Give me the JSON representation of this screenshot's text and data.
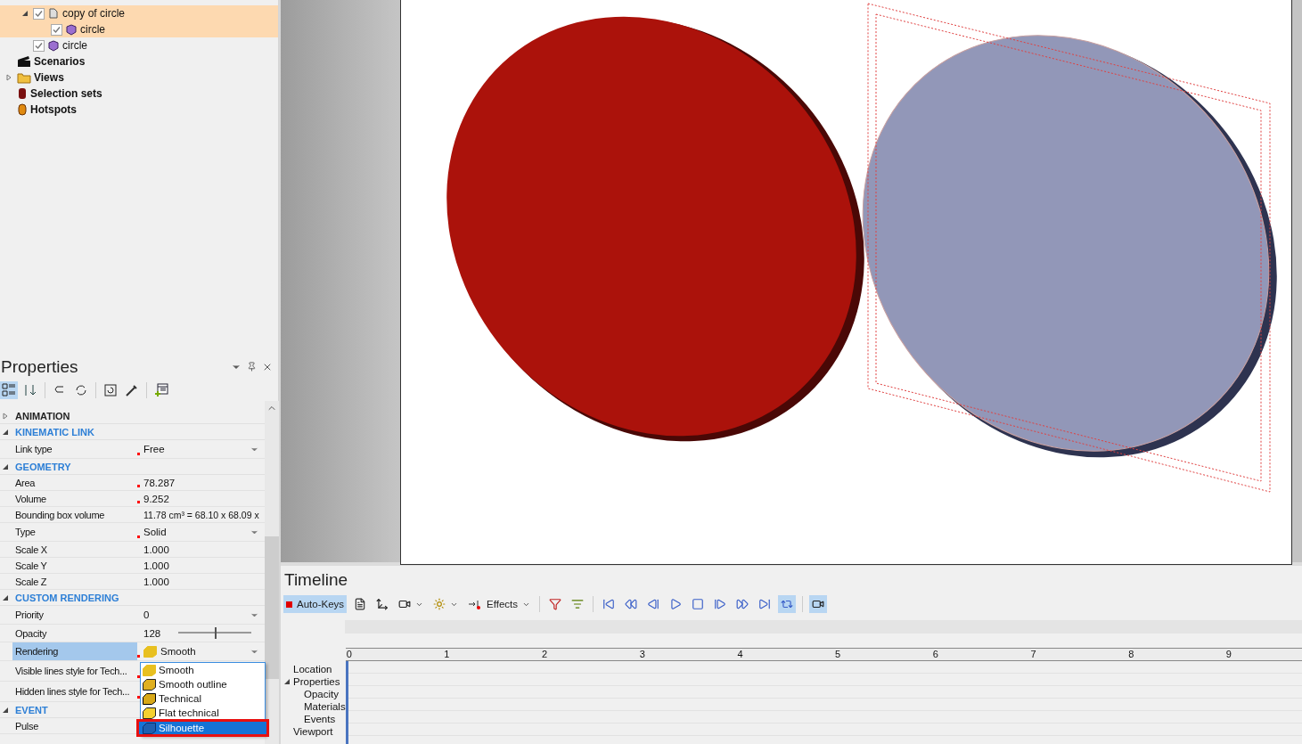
{
  "tree": {
    "items": [
      {
        "label": "copy of circle",
        "kind": "assembly",
        "checked": true,
        "expanded": true,
        "selected": true,
        "children": [
          {
            "label": "circle",
            "kind": "part",
            "checked": true,
            "selected": true
          }
        ]
      },
      {
        "label": "circle",
        "kind": "part",
        "checked": true,
        "selected": false
      },
      {
        "label": "Scenarios",
        "kind": "scenarios"
      },
      {
        "label": "Views",
        "kind": "views",
        "expanded": false
      },
      {
        "label": "Selection sets",
        "kind": "selection"
      },
      {
        "label": "Hotspots",
        "kind": "hotspots"
      }
    ]
  },
  "properties": {
    "title": "Properties",
    "view_buttons": [
      {
        "selected": true
      },
      {
        "selected": false
      }
    ],
    "sections": [
      {
        "title": "ANIMATION",
        "expanded": false,
        "highlight": false
      },
      {
        "title": "KINEMATIC LINK",
        "expanded": true,
        "highlight": true,
        "rows": [
          {
            "kind": "dropdown",
            "label": "Link type",
            "value": "Free",
            "modified": true,
            "selected": false
          }
        ]
      },
      {
        "title": "GEOMETRY",
        "expanded": true,
        "highlight": true,
        "rows": [
          {
            "kind": "text",
            "label": "Area",
            "value": "78.287",
            "modified": true,
            "selected": false
          },
          {
            "kind": "text",
            "label": "Volume",
            "value": "9.252",
            "modified": true,
            "selected": false
          },
          {
            "kind": "text",
            "label": "Bounding box volume",
            "value": "11.78 cm³ = 68.10 x 68.09 x",
            "modified": false,
            "selected": false
          },
          {
            "kind": "dropdown",
            "label": "Type",
            "value": "Solid",
            "modified": true,
            "selected": false
          },
          {
            "kind": "text",
            "label": "Scale X",
            "value": "1.000",
            "modified": false,
            "selected": false
          },
          {
            "kind": "text",
            "label": "Scale Y",
            "value": "1.000",
            "modified": false,
            "selected": false
          },
          {
            "kind": "text",
            "label": "Scale Z",
            "value": "1.000",
            "modified": false,
            "selected": false
          }
        ]
      },
      {
        "title": "CUSTOM RENDERING",
        "expanded": true,
        "highlight": true,
        "rows": [
          {
            "kind": "dropdown",
            "label": "Priority",
            "value": "0",
            "modified": false,
            "selected": false
          },
          {
            "kind": "slider",
            "label": "Opacity",
            "value": "128",
            "level": 0.5,
            "modified": false,
            "selected": false
          },
          {
            "kind": "dropdown",
            "label": "Rendering",
            "value": "Smooth",
            "modified": true,
            "selected": true
          },
          {
            "kind": "tall",
            "label": "Visible lines style for Tech...",
            "value": "",
            "modified": true,
            "selected": false
          },
          {
            "kind": "tall",
            "label": "Hidden lines style for Tech...",
            "value": "",
            "modified": true,
            "selected": false
          }
        ]
      },
      {
        "title": "EVENT",
        "expanded": true,
        "highlight": true,
        "rows": [
          {
            "kind": "text",
            "label": "Pulse",
            "value": "",
            "modified": false,
            "selected": false
          }
        ]
      }
    ],
    "menu": [
      {
        "label": "Smooth",
        "selected": false
      },
      {
        "label": "Smooth outline",
        "selected": false
      },
      {
        "label": "Technical",
        "selected": false
      },
      {
        "label": "Flat technical",
        "selected": false
      },
      {
        "label": "Silhouette",
        "selected": true
      }
    ]
  },
  "timeline": {
    "title": "Timeline",
    "auto_keys": {
      "label": "Auto-Keys",
      "on": true
    },
    "effects": {
      "label": "Effects"
    },
    "loop_on": true,
    "preview_on": true,
    "ruler": [
      "0",
      "1",
      "2",
      "3",
      "4",
      "5",
      "6",
      "7",
      "8",
      "9"
    ],
    "tracks": [
      {
        "label": "Location"
      },
      {
        "label": "Properties",
        "expanded": true,
        "children": [
          {
            "label": "Opacity"
          },
          {
            "label": "Materials"
          },
          {
            "label": "Events"
          }
        ]
      },
      {
        "label": "Viewport"
      }
    ]
  }
}
